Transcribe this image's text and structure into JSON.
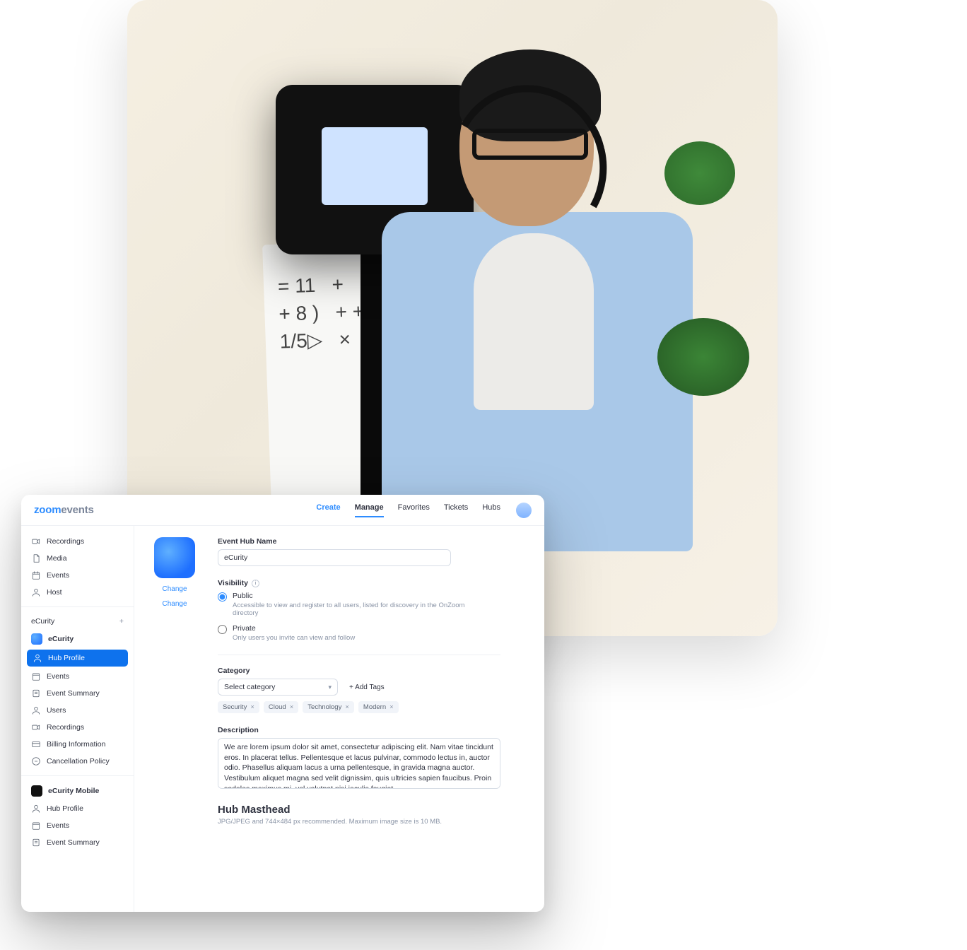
{
  "logo": {
    "zoom": "zoom",
    "events": "events"
  },
  "topnav": {
    "create": "Create",
    "manage": "Manage",
    "favorites": "Favorites",
    "tickets": "Tickets",
    "hubs": "Hubs",
    "active": "Manage"
  },
  "sidebar": {
    "top": {
      "recordings": "Recordings",
      "media": "Media",
      "events": "Events",
      "host": "Host"
    },
    "group_header": "eCurity",
    "hub1": {
      "title": "eCurity",
      "items": {
        "hub_profile": "Hub Profile",
        "events": "Events",
        "event_summary": "Event Summary",
        "users": "Users",
        "recordings": "Recordings",
        "billing_information": "Billing Information",
        "cancellation_policy": "Cancellation Policy"
      }
    },
    "hub2": {
      "title": "eCurity Mobile",
      "items": {
        "hub_profile": "Hub Profile",
        "events": "Events",
        "event_summary": "Event Summary"
      }
    }
  },
  "hubcard": {
    "change": "Change"
  },
  "form": {
    "hub_name_label": "Event Hub Name",
    "hub_name_value": "eCurity",
    "visibility_label": "Visibility",
    "public_label": "Public",
    "public_desc": "Accessible to view and register to all users, listed for discovery in the OnZoom directory",
    "private_label": "Private",
    "private_desc": "Only users you invite can view and follow",
    "category_label": "Category",
    "category_placeholder": "Select category",
    "add_tags": "+  Add Tags",
    "tags": [
      "Security",
      "Cloud",
      "Technology",
      "Modern"
    ],
    "description_label": "Description",
    "description_value": "We are lorem ipsum dolor sit amet, consectetur adipiscing elit. Nam vitae tincidunt eros. In placerat tellus. Pellentesque et lacus pulvinar, commodo lectus in, auctor odio. Phasellus aliquam lacus a urna pellentesque, in gravida magna auctor. Vestibulum aliquet magna sed velit dignissim, quis ultricies sapien faucibus. Proin sodales maximus mi, vel volutpat nisi iaculis feugiat",
    "masthead_title": "Hub Masthead",
    "masthead_hint": "JPG/JPEG and 744×484 px recommended. Maximum image size is 10 MB."
  }
}
